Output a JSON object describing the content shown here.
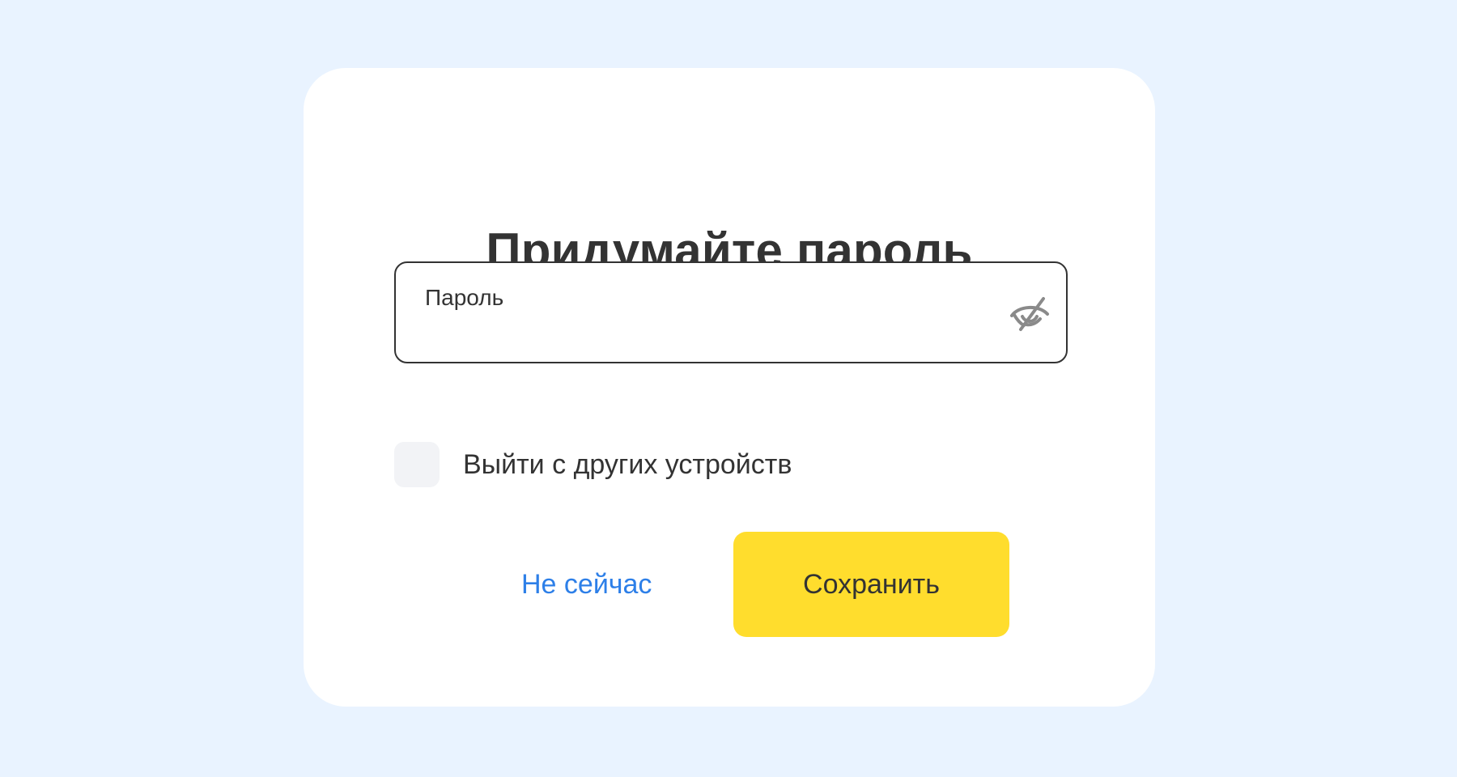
{
  "dialog": {
    "title": "Придумайте пароль",
    "password_field": {
      "label": "Пароль",
      "value": "",
      "visibility_icon": "eye-off-icon"
    },
    "logout_checkbox": {
      "label": "Выйти с других устройств",
      "checked": false
    },
    "actions": {
      "cancel_label": "Не сейчас",
      "save_label": "Сохранить"
    }
  },
  "colors": {
    "page_background": "#e9f3ff",
    "card_background": "#ffffff",
    "primary_button": "#ffdd2d",
    "link": "#2d7fe8",
    "text": "#333333",
    "checkbox_background": "#f2f3f6"
  }
}
